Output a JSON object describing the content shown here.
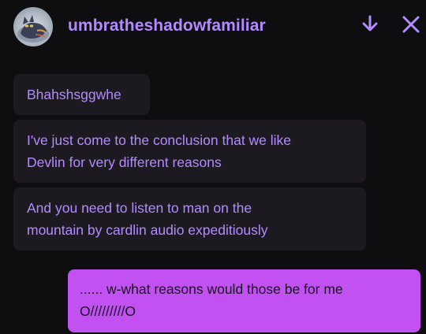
{
  "header": {
    "username": "umbratheshadowfamiliar",
    "avatar_icon": "cat-avatar-icon",
    "down_icon": "arrow-down-icon",
    "close_icon": "close-icon"
  },
  "messages": [
    {
      "sender": "umbratheshadowfamiliar",
      "lines": [
        "Bhahshsggwhe"
      ]
    },
    {
      "sender": "umbratheshadowfamiliar",
      "lines": [
        "I've just come to the conclusion that we like",
        "Devlin for very different reasons"
      ]
    },
    {
      "sender": "umbratheshadowfamiliar",
      "lines": [
        "And you need to listen to man on the",
        "mountain by cardlin audio expeditiously"
      ]
    },
    {
      "sender": "me",
      "lines": [
        "...... w-what reasons would those be for me",
        "O/////////O"
      ]
    }
  ],
  "colors": {
    "background": "#0e0d10",
    "accent": "#b38bff",
    "incoming_bubble": "#1c1a20",
    "outgoing_bubble": "#c151f0"
  }
}
